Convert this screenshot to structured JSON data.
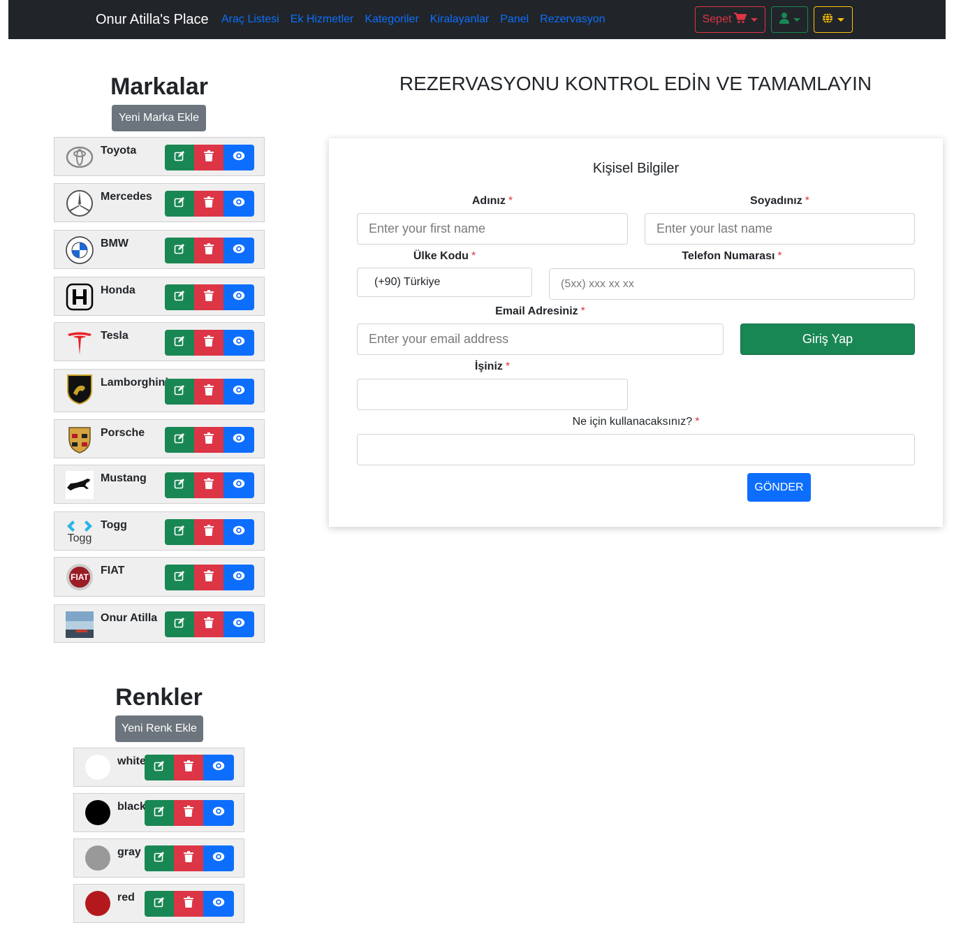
{
  "navbar": {
    "brand": "Onur Atilla's Place",
    "links": [
      "Araç Listesi",
      "Ek Hizmetler",
      "Kategoriler",
      "Kiralayanlar",
      "Panel",
      "Rezervasyon"
    ],
    "cart_label": "Sepet",
    "icons": {
      "cart": "cart-icon",
      "user": "user-icon",
      "lang": "globe-icon"
    },
    "colors": {
      "cart": "#dc3545",
      "user": "#198754",
      "lang": "#ffc107"
    }
  },
  "brands_section": {
    "title": "Markalar",
    "add_button": "Yeni Marka Ekle",
    "items": [
      {
        "name": "Toyota",
        "logo": "toyota-logo"
      },
      {
        "name": "Mercedes",
        "logo": "mercedes-logo"
      },
      {
        "name": "BMW",
        "logo": "bmw-logo"
      },
      {
        "name": "Honda",
        "logo": "honda-logo"
      },
      {
        "name": "Tesla",
        "logo": "tesla-logo"
      },
      {
        "name": "Lamborghini",
        "logo": "lamborghini-logo"
      },
      {
        "name": "Porsche",
        "logo": "porsche-logo"
      },
      {
        "name": "Mustang",
        "logo": "mustang-logo"
      },
      {
        "name": "Togg",
        "logo": "togg-logo",
        "logo_text": "Togg"
      },
      {
        "name": "FIAT",
        "logo": "fiat-logo",
        "logo_text": "FIAT"
      },
      {
        "name": "Onur Atilla",
        "logo": "photo-thumbnail"
      }
    ]
  },
  "colors_section": {
    "title": "Renkler",
    "add_button": "Yeni Renk Ekle",
    "items": [
      {
        "name": "white",
        "swatch": "#ffffff"
      },
      {
        "name": "black",
        "swatch": "#000000"
      },
      {
        "name": "gray",
        "swatch": "#999999"
      },
      {
        "name": "red",
        "swatch": "#b3191c"
      }
    ]
  },
  "actions": {
    "edit_icon": "edit-icon",
    "delete_icon": "trash-icon",
    "view_icon": "eye-icon"
  },
  "reservation": {
    "heading": "REZERVASYONU KONTROL EDİN VE TAMAMLAYIN",
    "subtitle": "Kişisel Bilgiler",
    "required_mark": "*",
    "first_name": {
      "label": "Adınız",
      "placeholder": "Enter your first name"
    },
    "last_name": {
      "label": "Soyadınız",
      "placeholder": "Enter your last name"
    },
    "country_code": {
      "label": "Ülke Kodu",
      "value": "(+90) Türkiye"
    },
    "phone": {
      "label": "Telefon Numarası",
      "placeholder": "(5xx) xxx xx xx"
    },
    "email": {
      "label": "Email Adresiniz",
      "placeholder": "Enter your email address"
    },
    "login_button": "Giriş Yap",
    "job": {
      "label": "İşiniz"
    },
    "purpose": {
      "label": "Ne için kullanacaksınız?"
    },
    "submit_button": "GÖNDER"
  }
}
